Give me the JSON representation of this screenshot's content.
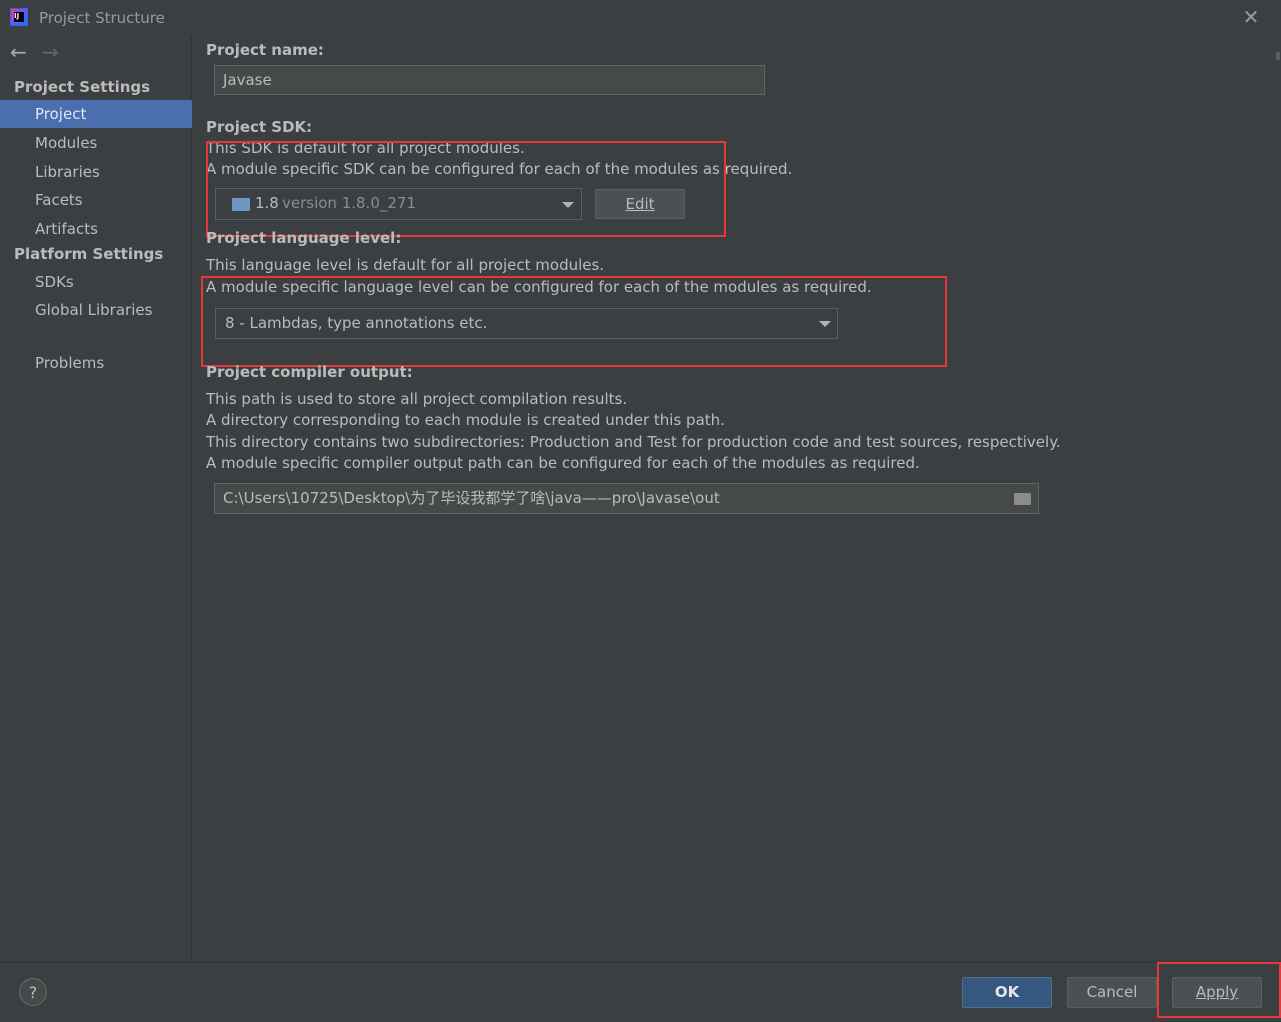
{
  "window": {
    "title": "Project Structure",
    "close_glyph": "✕"
  },
  "nav": {
    "back_glyph": "←",
    "forward_glyph": "→"
  },
  "sidebar": {
    "project_settings_heading": "Project Settings",
    "project_settings_items": [
      {
        "label": "Project",
        "selected": true
      },
      {
        "label": "Modules"
      },
      {
        "label": "Libraries"
      },
      {
        "label": "Facets"
      },
      {
        "label": "Artifacts"
      }
    ],
    "platform_settings_heading": "Platform Settings",
    "platform_settings_items": [
      {
        "label": "SDKs"
      },
      {
        "label": "Global Libraries"
      }
    ],
    "problems": "Problems"
  },
  "project_name": {
    "label": "Project name:",
    "value": "Javase"
  },
  "project_sdk": {
    "label": "Project SDK:",
    "line1": "This SDK is default for all project modules.",
    "line2": "A module specific SDK can be configured for each of the modules as required.",
    "selected_version": "1.8",
    "selected_detail": "version 1.8.0_271",
    "edit_button": "Edit"
  },
  "language_level": {
    "label": "Project language level:",
    "line1": "This language level is default for all project modules.",
    "line2": "A module specific language level can be configured for each of the modules as required.",
    "selected": "8 - Lambdas, type annotations etc."
  },
  "compiler_output": {
    "label": "Project compiler output:",
    "line1": "This path is used to store all project compilation results.",
    "line2": "A directory corresponding to each module is created under this path.",
    "line3": "This directory contains two subdirectories: Production and Test for production code and test sources, respectively.",
    "line4": "A module specific compiler output path can be configured for each of the modules as required.",
    "path": "C:\\Users\\10725\\Desktop\\为了毕设我都学了啥\\java——pro\\Javase\\out"
  },
  "footer": {
    "help": "?",
    "ok": "OK",
    "cancel": "Cancel",
    "apply": "Apply"
  },
  "colors": {
    "background": "#3c3f41",
    "selection": "#4b6eaf",
    "highlight_box": "#e53838",
    "ok_button": "#365880"
  }
}
